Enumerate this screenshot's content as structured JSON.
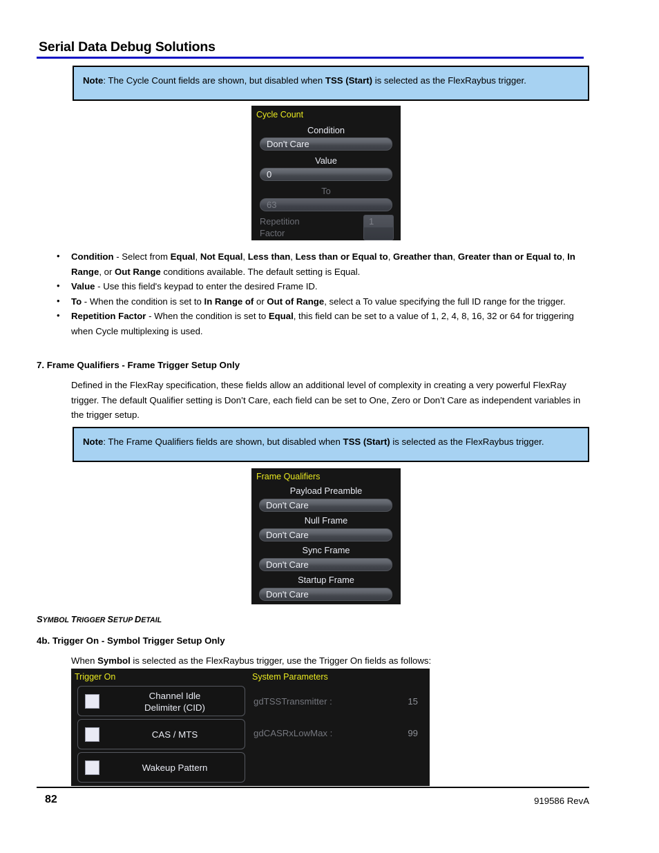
{
  "document": {
    "header_title": "Serial Data Debug Solutions",
    "accent_rule_color": "#1112c4",
    "footer": {
      "page_number": "82",
      "revision": "919586 RevA"
    }
  },
  "notes": [
    {
      "label": "Note",
      "text_before": ": The Cycle Count fields are shown, but disabled when ",
      "bold_term": "TSS (Start)",
      "text_after": " is selected as the FlexRaybus trigger.",
      "background_color": "#a7d2f2",
      "border_color": "#000000"
    },
    {
      "label": "Note",
      "text_before": ": The Frame Qualifiers fields are shown, but disabled when ",
      "bold_term": "TSS (Start)",
      "text_after": " is selected as the FlexRaybus trigger.",
      "background_color": "#a7d2f2",
      "border_color": "#000000"
    }
  ],
  "cycle_count_panel": {
    "title": "Cycle Count",
    "accent_color": "#e8e820",
    "background_color": "#161616",
    "fields": [
      {
        "label": "Condition",
        "value": "Don't Care",
        "disabled": false
      },
      {
        "label": "Value",
        "value": "0",
        "disabled": false
      },
      {
        "label": "To",
        "value": "63",
        "disabled": true
      }
    ],
    "repetition": {
      "label_line1": "Repetition",
      "label_line2": "Factor",
      "value": "1",
      "disabled": true
    }
  },
  "bullets": [
    {
      "term": "Condition",
      "segments": [
        {
          "t": " - Select from ",
          "b": false
        },
        {
          "t": "Equal",
          "b": true
        },
        {
          "t": ", ",
          "b": false
        },
        {
          "t": "Not Equal",
          "b": true
        },
        {
          "t": ", ",
          "b": false
        },
        {
          "t": "Less than",
          "b": true
        },
        {
          "t": ", ",
          "b": false
        },
        {
          "t": "Less than or Equal to",
          "b": true
        },
        {
          "t": ", ",
          "b": false
        },
        {
          "t": "Greather than",
          "b": true
        },
        {
          "t": ", ",
          "b": false
        },
        {
          "t": "Greater than or Equal to",
          "b": true
        },
        {
          "t": ", ",
          "b": false
        },
        {
          "t": "In Range",
          "b": true
        },
        {
          "t": ", or ",
          "b": false
        },
        {
          "t": "Out Range",
          "b": true
        },
        {
          "t": " conditions available. The default setting is Equal.",
          "b": false
        }
      ]
    },
    {
      "term": "Value",
      "segments": [
        {
          "t": " - Use this field's keypad to enter the desired Frame ID.",
          "b": false
        }
      ]
    },
    {
      "term": "To",
      "segments": [
        {
          "t": " - When the condition is set to ",
          "b": false
        },
        {
          "t": "In Range of",
          "b": true
        },
        {
          "t": " or ",
          "b": false
        },
        {
          "t": "Out of Range",
          "b": true
        },
        {
          "t": ", select a To value specifying the full ID range for the trigger.",
          "b": false
        }
      ]
    },
    {
      "term": "Repetition Factor",
      "segments": [
        {
          "t": " - When the condition is set to ",
          "b": false
        },
        {
          "t": "Equal",
          "b": true
        },
        {
          "t": ", this field can be set to a value of 1, 2, 4, 8, 16, 32 or 64 for triggering when Cycle multiplexing is used.",
          "b": false
        }
      ]
    }
  ],
  "section_7": {
    "heading": "7. Frame Qualifiers - Frame Trigger Setup Only",
    "paragraph": "Defined in the FlexRay specification, these fields allow an additional level of complexity in creating a very powerful FlexRay trigger. The default Qualifier setting is Don’t Care, each field can be set to One, Zero or Don’t Care as independent variables in the trigger setup."
  },
  "frame_qualifiers_panel": {
    "title": "Frame Qualifiers",
    "accent_color": "#e8e820",
    "background_color": "#161616",
    "fields": [
      {
        "label": "Payload Preamble",
        "value": "Don't  Care"
      },
      {
        "label": "Null Frame",
        "value": "Don't  Care"
      },
      {
        "label": "Sync Frame",
        "value": "Don't  Care"
      },
      {
        "label": "Startup Frame",
        "value": "Don't  Care"
      }
    ]
  },
  "symbol_section": {
    "smallcaps_heading_parts": [
      {
        "t": "S",
        "big": true
      },
      {
        "t": "YMBOL ",
        "big": false
      },
      {
        "t": "T",
        "big": true
      },
      {
        "t": "RIGGER ",
        "big": false
      },
      {
        "t": "S",
        "big": true
      },
      {
        "t": "ETUP ",
        "big": false
      },
      {
        "t": "D",
        "big": true
      },
      {
        "t": "ETAIL",
        "big": false
      }
    ],
    "heading_4b": "4b. Trigger On - Symbol Trigger Setup Only",
    "paragraph_before": "When ",
    "paragraph_bold": "Symbol",
    "paragraph_after": " is selected as the FlexRaybus trigger, use the Trigger On fields as follows:"
  },
  "trigger_on_panel": {
    "title_left": "Trigger On",
    "title_right": "System Parameters",
    "accent_color": "#e8e820",
    "background_color": "#161616",
    "checkbox_items": [
      {
        "line1": "Channel Idle",
        "line2": "Delimiter (CID)",
        "checked": false
      },
      {
        "line1": "CAS / MTS",
        "line2": "",
        "checked": false
      },
      {
        "line1": "Wakeup  Pattern",
        "line2": "",
        "checked": false
      }
    ],
    "system_parameters": [
      {
        "name": "gdTSSTransmitter :",
        "value": "15"
      },
      {
        "name": "gdCASRxLowMax :",
        "value": "99"
      }
    ]
  }
}
